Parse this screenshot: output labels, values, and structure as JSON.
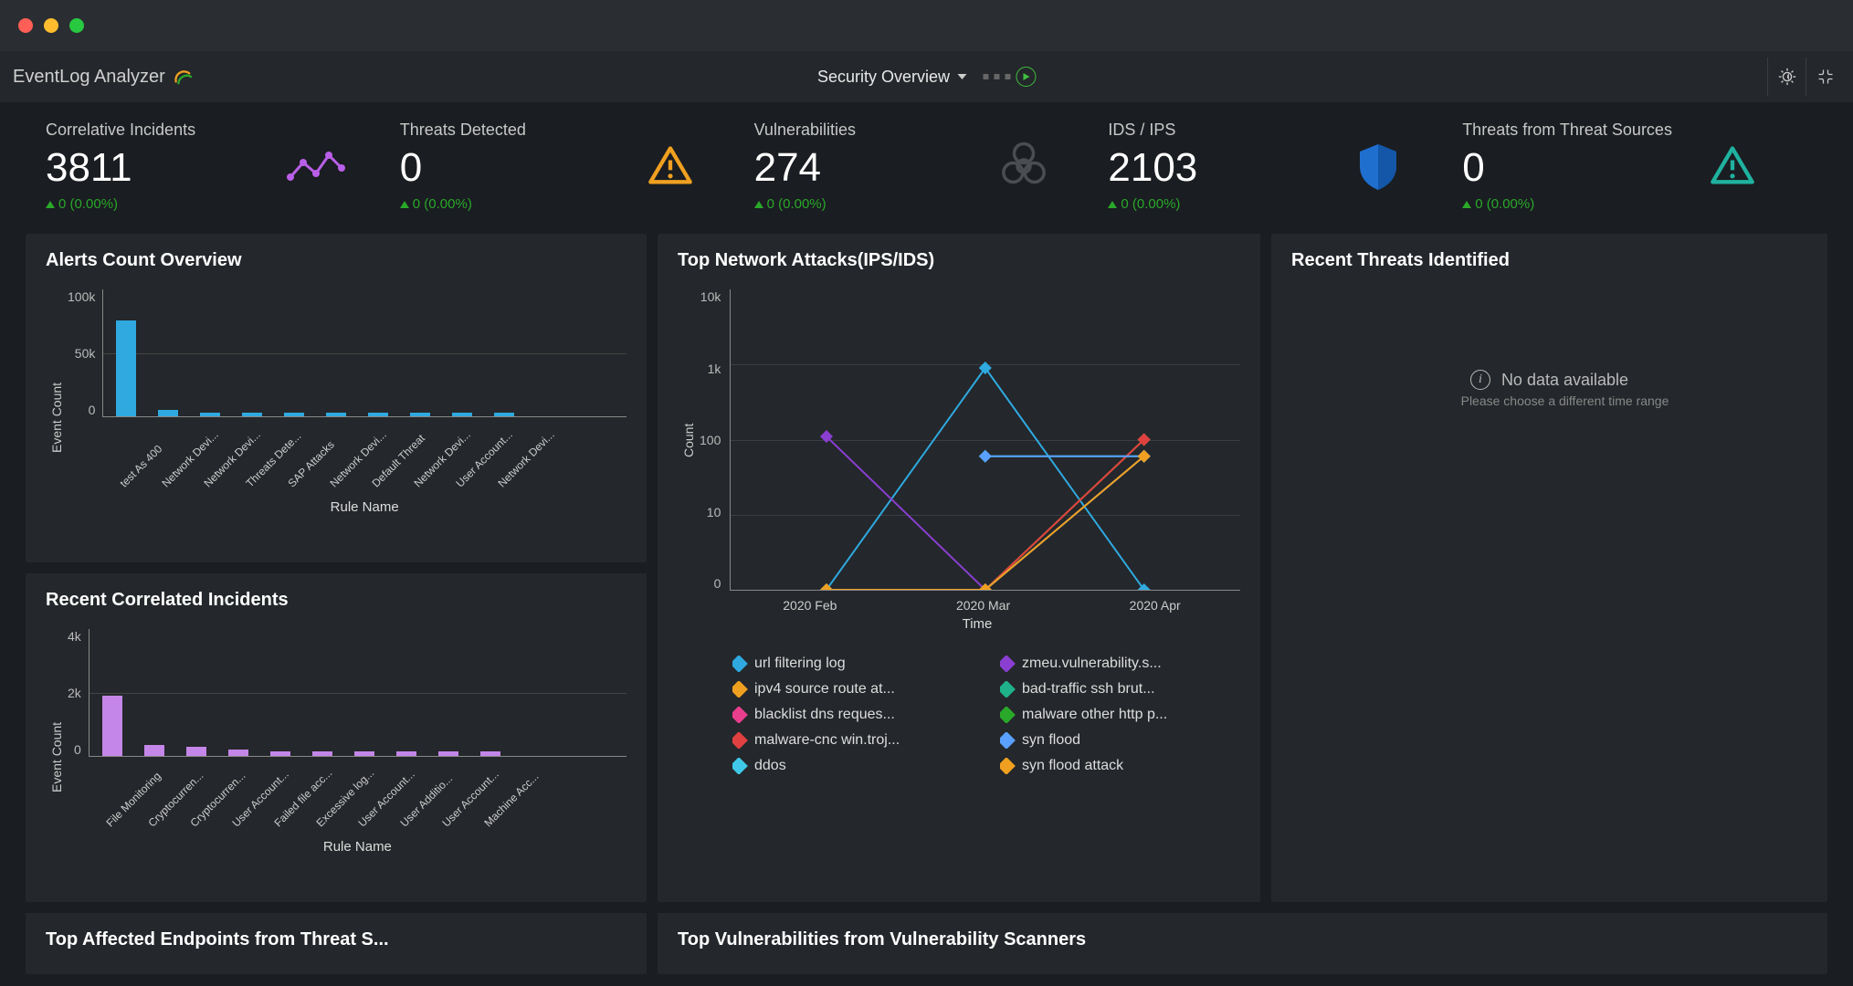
{
  "brand": "EventLog Analyzer",
  "header": {
    "title": "Security Overview"
  },
  "kpis": [
    {
      "label": "Correlative Incidents",
      "value": "3811",
      "delta": "0 (0.00%)"
    },
    {
      "label": "Threats Detected",
      "value": "0",
      "delta": "0 (0.00%)"
    },
    {
      "label": "Vulnerabilities",
      "value": "274",
      "delta": "0 (0.00%)"
    },
    {
      "label": "IDS / IPS",
      "value": "2103",
      "delta": "0 (0.00%)"
    },
    {
      "label": "Threats from Threat Sources",
      "value": "0",
      "delta": "0 (0.00%)"
    }
  ],
  "panels": {
    "alerts": {
      "title": "Alerts Count Overview",
      "ylabel": "Event Count",
      "xtitle": "Rule Name"
    },
    "recent_corr": {
      "title": "Recent Correlated Incidents",
      "ylabel": "Event Count",
      "xtitle": "Rule Name"
    },
    "network": {
      "title": "Top Network Attacks(IPS/IDS)",
      "ylabel": "Count",
      "xtitle": "Time"
    },
    "recent_threats": {
      "title": "Recent Threats Identified",
      "nodata": "No data available",
      "nodata_sub": "Please choose a different time range"
    },
    "bottom1": {
      "title": "Top Affected Endpoints from Threat S..."
    },
    "bottom2": {
      "title": "Top Vulnerabilities from Vulnerability Scanners"
    }
  },
  "chart_data": {
    "alerts": {
      "type": "bar",
      "ylabel": "Event Count",
      "xlabel": "Rule Name",
      "ylim": [
        0,
        100000
      ],
      "yticks": [
        "100k",
        "50k",
        "0"
      ],
      "categories": [
        "test As 400",
        "Network Devi...",
        "Network Devi...",
        "Threats Dete...",
        "SAP Attacks",
        "Network Devi...",
        "Default Threat",
        "Network Devi...",
        "User Account...",
        "Network Devi..."
      ],
      "values": [
        75000,
        5000,
        3000,
        3000,
        3000,
        3000,
        3000,
        3000,
        3000,
        3000
      ]
    },
    "recent_corr": {
      "type": "bar",
      "ylabel": "Event Count",
      "xlabel": "Rule Name",
      "ylim": [
        0,
        4000
      ],
      "yticks": [
        "4k",
        "2k",
        "0"
      ],
      "categories": [
        "File Monitoring",
        "Cryptocurren...",
        "Cryptocurren...",
        "User Account...",
        "Failed file acc...",
        "Excessive log...",
        "User Account...",
        "User Additio...",
        "User Account...",
        "Machine Acc..."
      ],
      "values": [
        1900,
        350,
        300,
        200,
        150,
        150,
        150,
        150,
        150,
        150
      ]
    },
    "network": {
      "type": "line",
      "ylabel": "Count",
      "xlabel": "Time",
      "yscale": "log",
      "yticks": [
        "10k",
        "1k",
        "100",
        "10",
        "0"
      ],
      "x": [
        "2020 Feb",
        "2020 Mar",
        "2020 Apr"
      ],
      "series": [
        {
          "name": "url filtering log",
          "color": "#2fa9e0",
          "marker": "diamond",
          "values": [
            0,
            900,
            0
          ]
        },
        {
          "name": "zmeu.vulnerability.s...",
          "color": "#8a3fd1",
          "marker": "diamond",
          "values": [
            110,
            0,
            null
          ]
        },
        {
          "name": "ipv4 source route at...",
          "color": "#f0a020",
          "marker": "square",
          "values": [
            0,
            0,
            100
          ]
        },
        {
          "name": "bad-traffic ssh brut...",
          "color": "#1fb28a",
          "marker": "triangle",
          "values": [
            null,
            60,
            60
          ]
        },
        {
          "name": "blacklist dns reques...",
          "color": "#e83e8c",
          "marker": "star",
          "values": [
            0,
            0,
            60
          ]
        },
        {
          "name": "malware other http p...",
          "color": "#2aa82a",
          "marker": "diamond",
          "values": [
            0,
            0,
            100
          ]
        },
        {
          "name": "malware-cnc win.troj...",
          "color": "#e04040",
          "marker": "diamond",
          "values": [
            0,
            0,
            100
          ]
        },
        {
          "name": "syn flood",
          "color": "#5aa0ff",
          "marker": "square",
          "values": [
            null,
            60,
            60
          ]
        },
        {
          "name": "ddos",
          "color": "#40c8e8",
          "marker": "plus",
          "values": [
            0,
            0,
            60
          ]
        },
        {
          "name": "syn flood attack",
          "color": "#f0a020",
          "marker": "triangle-down",
          "values": [
            0,
            0,
            60
          ]
        }
      ]
    }
  }
}
